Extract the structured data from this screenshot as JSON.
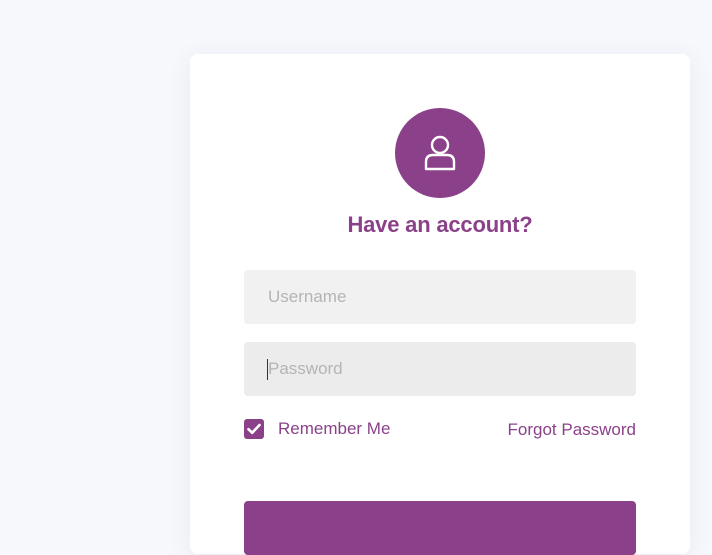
{
  "login": {
    "avatar_icon": "user-icon",
    "title": "Have an account?",
    "username": {
      "placeholder": "Username",
      "value": ""
    },
    "password": {
      "placeholder": "Password",
      "value": ""
    },
    "remember_me": {
      "label": "Remember Me",
      "checked": true
    },
    "forgot_password_label": "Forgot Password",
    "submit_label": ""
  },
  "colors": {
    "accent": "#8b418a",
    "page_background": "#f7f8fc",
    "card_background": "#ffffff",
    "input_background": "#f1f1f1"
  }
}
